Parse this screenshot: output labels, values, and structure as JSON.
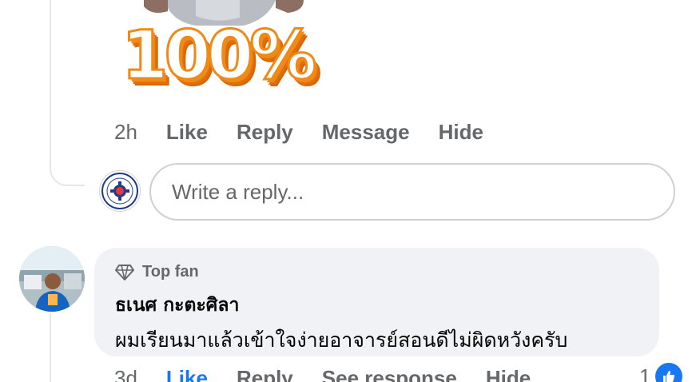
{
  "sticker": {
    "text": "100%"
  },
  "top_comment_actions": {
    "time": "2h",
    "like": "Like",
    "reply": "Reply",
    "message": "Message",
    "hide": "Hide"
  },
  "reply_box": {
    "placeholder": "Write a reply..."
  },
  "comment": {
    "badge": "Top fan",
    "author": "ธเนศ กะตะศิลา",
    "text": "ผมเรียนมาแล้วเข้าใจง่ายอาจารย์สอนดีไม่ผิดหวังครับ",
    "actions": {
      "time": "3d",
      "like": "Like",
      "reply": "Reply",
      "see_response": "See response",
      "hide": "Hide"
    },
    "reaction_count": "1",
    "reaction_icon": "thumbs-up-icon"
  },
  "colors": {
    "accent": "#1877f2",
    "secondary_text": "#65676b",
    "bubble_bg": "#f0f2f5",
    "sticker_orange": "#f08a16"
  }
}
